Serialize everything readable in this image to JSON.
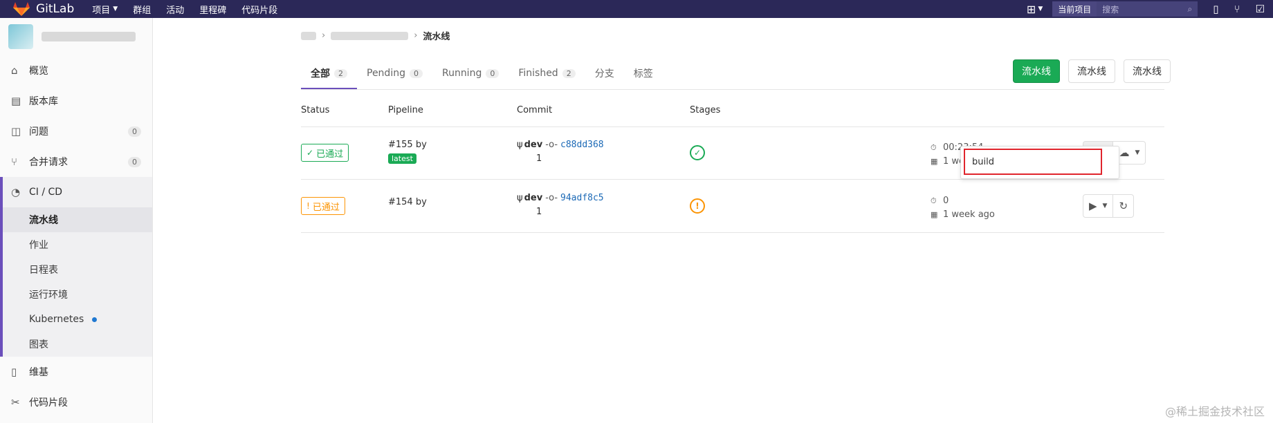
{
  "topbar": {
    "brand": "GitLab",
    "nav": [
      "项目",
      "群组",
      "活动",
      "里程碑",
      "代码片段"
    ],
    "scope": "当前项目",
    "search_placeholder": "搜索",
    "colors": {
      "bg": "#2b2858"
    }
  },
  "sidebar": {
    "items": [
      {
        "label": "概览",
        "icon": "home-icon"
      },
      {
        "label": "版本库",
        "icon": "doc-icon"
      },
      {
        "label": "问题",
        "icon": "issues-icon",
        "count": "0"
      },
      {
        "label": "合并请求",
        "icon": "merge-icon",
        "count": "0"
      }
    ],
    "ci": {
      "label": "CI / CD",
      "sub": [
        "流水线",
        "作业",
        "日程表",
        "运行环境",
        "Kubernetes",
        "图表"
      ]
    },
    "bottom": [
      {
        "label": "维基",
        "icon": "book-icon"
      },
      {
        "label": "代码片段",
        "icon": "scissors-icon"
      }
    ]
  },
  "breadcrumb": {
    "current": "流水线"
  },
  "tabs": [
    {
      "label": "全部",
      "count": "2"
    },
    {
      "label": "Pending",
      "count": "0"
    },
    {
      "label": "Running",
      "count": "0"
    },
    {
      "label": "Finished",
      "count": "2"
    },
    {
      "label": "分支"
    },
    {
      "label": "标签"
    }
  ],
  "buttons": {
    "run": "流水线",
    "clear": "流水线",
    "settings": "流水线"
  },
  "table": {
    "headers": {
      "status": "Status",
      "pipeline": "Pipeline",
      "commit": "Commit",
      "stages": "Stages"
    },
    "rows": [
      {
        "status": "已通过",
        "pipeline": "#155 by",
        "tag": "latest",
        "branch": "dev",
        "sha": "c88dd368",
        "commit_line2": "1",
        "duration": "00:23:54",
        "finished": "1 week ago"
      },
      {
        "status": "已通过",
        "pipeline": "#154 by",
        "branch": "dev",
        "sha": "94adf8c5",
        "commit_line2": "1",
        "duration": "0",
        "finished": "1 week ago"
      }
    ]
  },
  "dropdown": {
    "item": "build"
  },
  "watermark": "@稀土掘金技术社区"
}
